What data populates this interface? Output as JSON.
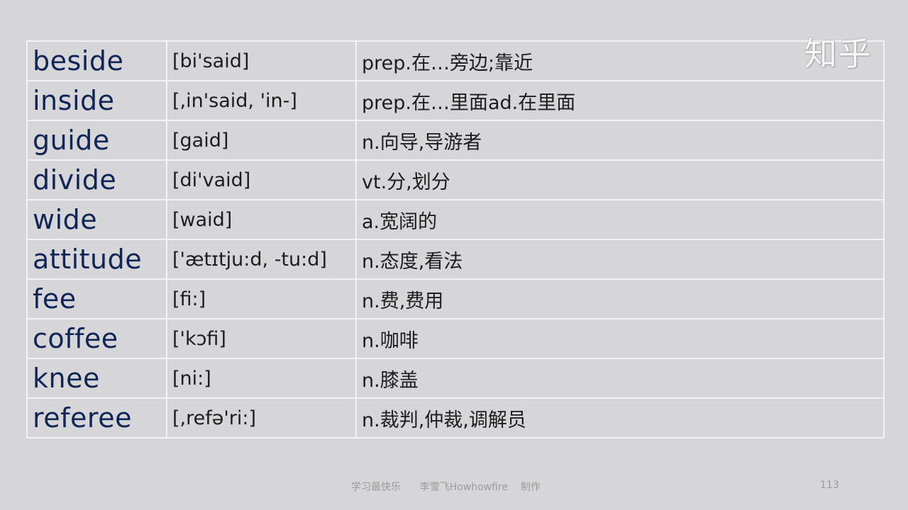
{
  "watermark": "知乎",
  "rows": [
    {
      "word": "beside",
      "phonetic": "[bi'said]",
      "meaning": "prep.在…旁边;靠近"
    },
    {
      "word": "inside",
      "phonetic": "[,in'said, 'in-]",
      "meaning": "prep.在…里面ad.在里面"
    },
    {
      "word": "guide",
      "phonetic": "[gaid]",
      "meaning": "n.向导,导游者"
    },
    {
      "word": "divide",
      "phonetic": "[di'vaid]",
      "meaning": "vt.分,划分"
    },
    {
      "word": "wide",
      "phonetic": "[waid]",
      "meaning": "a.宽阔的"
    },
    {
      "word": "attitude",
      "phonetic": "['ætɪtju:d, -tu:d]",
      "meaning": "n.态度,看法"
    },
    {
      "word": "fee",
      "phonetic": "[fi:]",
      "meaning": "n.费,费用"
    },
    {
      "word": "coffee",
      "phonetic": "['kɔfi]",
      "meaning": "n.咖啡"
    },
    {
      "word": "knee",
      "phonetic": "[ni:]",
      "meaning": "n.膝盖"
    },
    {
      "word": "referee",
      "phonetic": "[,refə'ri:]",
      "meaning": "n.裁判,仲裁,调解员"
    }
  ],
  "footer": {
    "text": "学习最快乐      李雪飞Howhowfire    制作",
    "page_number": "113"
  }
}
